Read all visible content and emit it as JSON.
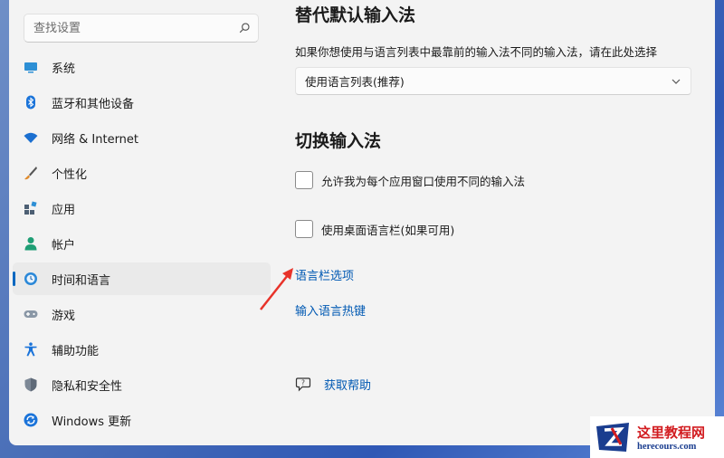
{
  "sidebar": {
    "search_placeholder": "查找设置",
    "items": [
      {
        "label": "系统",
        "icon": "system-display-icon"
      },
      {
        "label": "蓝牙和其他设备",
        "icon": "bluetooth-icon"
      },
      {
        "label": "网络 & Internet",
        "icon": "wifi-icon"
      },
      {
        "label": "个性化",
        "icon": "brush-icon"
      },
      {
        "label": "应用",
        "icon": "apps-icon"
      },
      {
        "label": "帐户",
        "icon": "account-icon"
      },
      {
        "label": "时间和语言",
        "icon": "globe-clock-icon",
        "active": true
      },
      {
        "label": "游戏",
        "icon": "gamepad-icon"
      },
      {
        "label": "辅助功能",
        "icon": "accessibility-icon"
      },
      {
        "label": "隐私和安全性",
        "icon": "shield-icon"
      },
      {
        "label": "Windows 更新",
        "icon": "windows-update-icon"
      }
    ]
  },
  "main": {
    "override_title": "替代默认输入法",
    "override_desc": "如果你想使用与语言列表中最靠前的输入法不同的输入法，请在此处选择",
    "override_select_value": "使用语言列表(推荐)",
    "switch_title": "切换输入法",
    "checkbox_per_app": {
      "label": "允许我为每个应用窗口使用不同的输入法",
      "checked": false
    },
    "checkbox_desktop_bar": {
      "label": "使用桌面语言栏(如果可用)",
      "checked": false
    },
    "link_language_bar": "语言栏选项",
    "link_hotkeys": "输入语言热键",
    "get_help": "获取帮助"
  },
  "watermark": {
    "name": "这里教程网",
    "url": "herecours.com"
  },
  "colors": {
    "accent": "#0067c0",
    "link": "#0059b3",
    "annotation_arrow": "#e8332a"
  }
}
